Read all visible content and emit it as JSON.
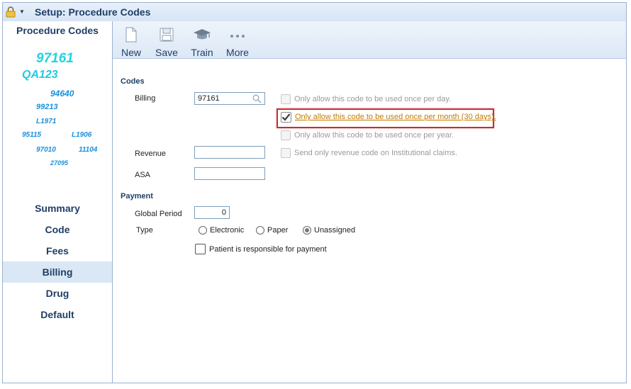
{
  "window": {
    "title": "Setup: Procedure Codes"
  },
  "sidebar": {
    "heading": "Procedure Codes",
    "code_cloud": [
      "97161",
      "QA123",
      "94640",
      "99213",
      "L1971",
      "95115",
      "L1906",
      "97010",
      "11104",
      "27095"
    ],
    "nav": [
      {
        "label": "Summary",
        "active": false
      },
      {
        "label": "Code",
        "active": false
      },
      {
        "label": "Fees",
        "active": false
      },
      {
        "label": "Billing",
        "active": true
      },
      {
        "label": "Drug",
        "active": false
      },
      {
        "label": "Default",
        "active": false
      }
    ]
  },
  "toolbar": {
    "new_label": "New",
    "save_label": "Save",
    "train_label": "Train",
    "more_label": "More"
  },
  "codes": {
    "section_label": "Codes",
    "billing_label": "Billing",
    "billing_value": "97161",
    "revenue_label": "Revenue",
    "revenue_value": "",
    "asa_label": "ASA",
    "asa_value": "",
    "options": {
      "once_per_day": {
        "label": "Only allow this code to be used once per day.",
        "checked": false
      },
      "once_per_month": {
        "label": "Only allow this code to be used once per month (30 days).",
        "checked": true
      },
      "once_per_year": {
        "label": "Only allow this code to be used once per year.",
        "checked": false
      },
      "revenue_only": {
        "label": "Send only revenue code on Institutional claims.",
        "checked": false
      }
    }
  },
  "payment": {
    "section_label": "Payment",
    "global_period_label": "Global Period",
    "global_period_value": "0",
    "type_label": "Type",
    "type_options": [
      "Electronic",
      "Paper",
      "Unassigned"
    ],
    "type_selected": "Unassigned",
    "patient_responsible_label": "Patient is responsible for payment",
    "patient_responsible_checked": false
  },
  "colors": {
    "highlight_border": "#d9262b",
    "link_orange": "#c47a00",
    "nav_text": "#1f3f66",
    "cloud_text": "#1a8fdb"
  }
}
